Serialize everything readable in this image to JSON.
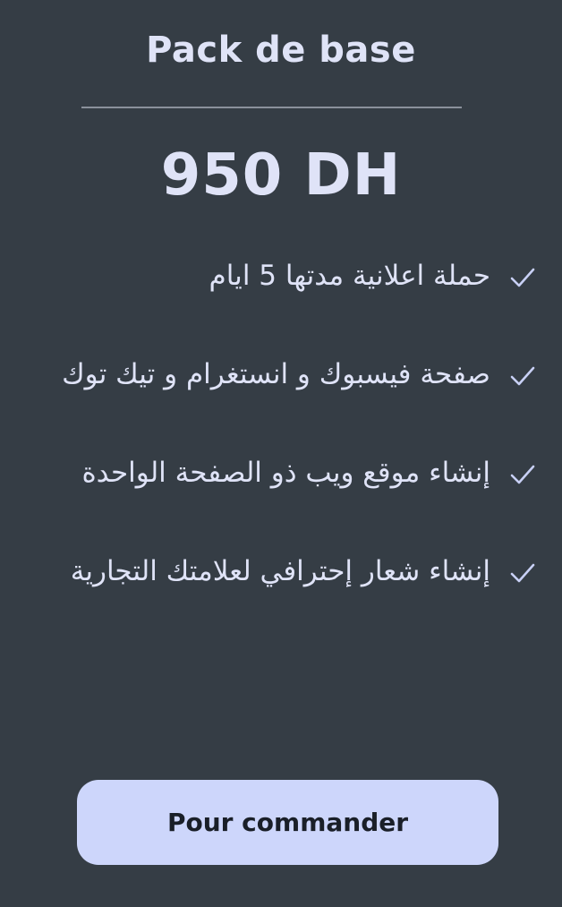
{
  "card": {
    "title": "Pack de base",
    "price": "950 DH",
    "features": [
      {
        "text": "حملة اعلانية مدتها 5 ايام",
        "icon": "check-icon"
      },
      {
        "text": "صفحة فيسبوك و انستغرام و تيك توك",
        "icon": "check-icon"
      },
      {
        "text": "إنشاء موقع ويب ذو الصفحة الواحدة",
        "icon": "check-icon"
      },
      {
        "text": "إنشاء شعار إحترافي لعلامتك التجارية",
        "icon": "check-icon"
      }
    ],
    "button_label": "Pour commander"
  },
  "colors": {
    "background": "#353d45",
    "text": "#dfe3f7",
    "divider": "#8a919b",
    "button_background": "#cdd6fb",
    "button_text": "#1a1f28",
    "check": "#c8d0f5"
  }
}
